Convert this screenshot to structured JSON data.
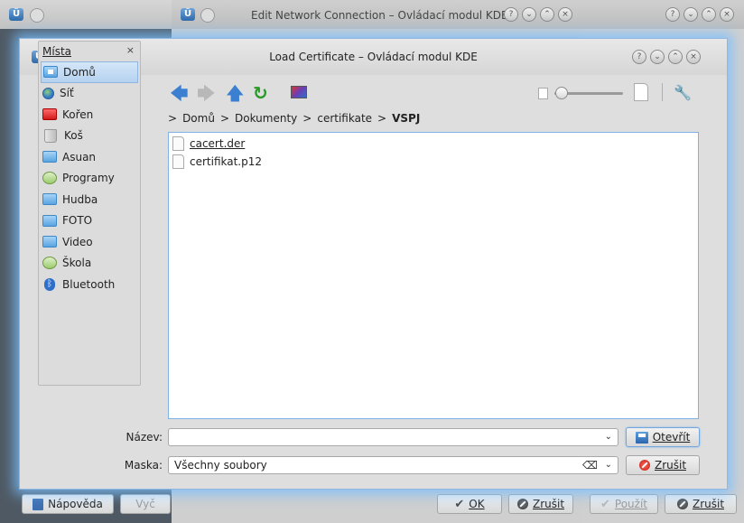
{
  "colors": {
    "accent": "#7fb2e6",
    "glow": "#78beff"
  },
  "bg_window_left": {
    "logo": "ÜÜ"
  },
  "bg_window_center": {
    "title": "Edit Network Connection – Ovládací modul KDE",
    "ok_label": "OK",
    "cancel_label": "Zrušit"
  },
  "bg_window_right": {
    "apply_label": "Použít",
    "cancel_label": "Zrušit"
  },
  "bottom_left": {
    "help_label": "Nápověda",
    "partial_label": "Vyč"
  },
  "dialog": {
    "title": "Load Certificate – Ovládací modul KDE",
    "places": {
      "header": "Místa",
      "items": [
        {
          "label": "Domů",
          "icon": "home-folder-icon",
          "selected": true
        },
        {
          "label": "Síť",
          "icon": "network-icon"
        },
        {
          "label": "Kořen",
          "icon": "root-folder-icon"
        },
        {
          "label": "Koš",
          "icon": "trash-icon"
        },
        {
          "label": "Asuan",
          "icon": "folder-icon"
        },
        {
          "label": "Programy",
          "icon": "network-folder-icon"
        },
        {
          "label": "Hudba",
          "icon": "folder-icon"
        },
        {
          "label": "FOTO",
          "icon": "folder-icon"
        },
        {
          "label": "Video",
          "icon": "folder-icon"
        },
        {
          "label": "Škola",
          "icon": "network-folder-icon"
        },
        {
          "label": "Bluetooth",
          "icon": "bluetooth-icon"
        }
      ]
    },
    "breadcrumb": {
      "items": [
        "Domů",
        "Dokumenty",
        "certifikate"
      ],
      "current": "VSPJ",
      "separator": ">"
    },
    "files": [
      {
        "name": "cacert.der"
      },
      {
        "name": "certifikat.p12"
      }
    ],
    "name_label": "Název:",
    "name_value": "",
    "mask_label": "Maska:",
    "mask_value": "Všechny soubory",
    "open_label": "Otevřít",
    "cancel_label": "Zrušit"
  }
}
